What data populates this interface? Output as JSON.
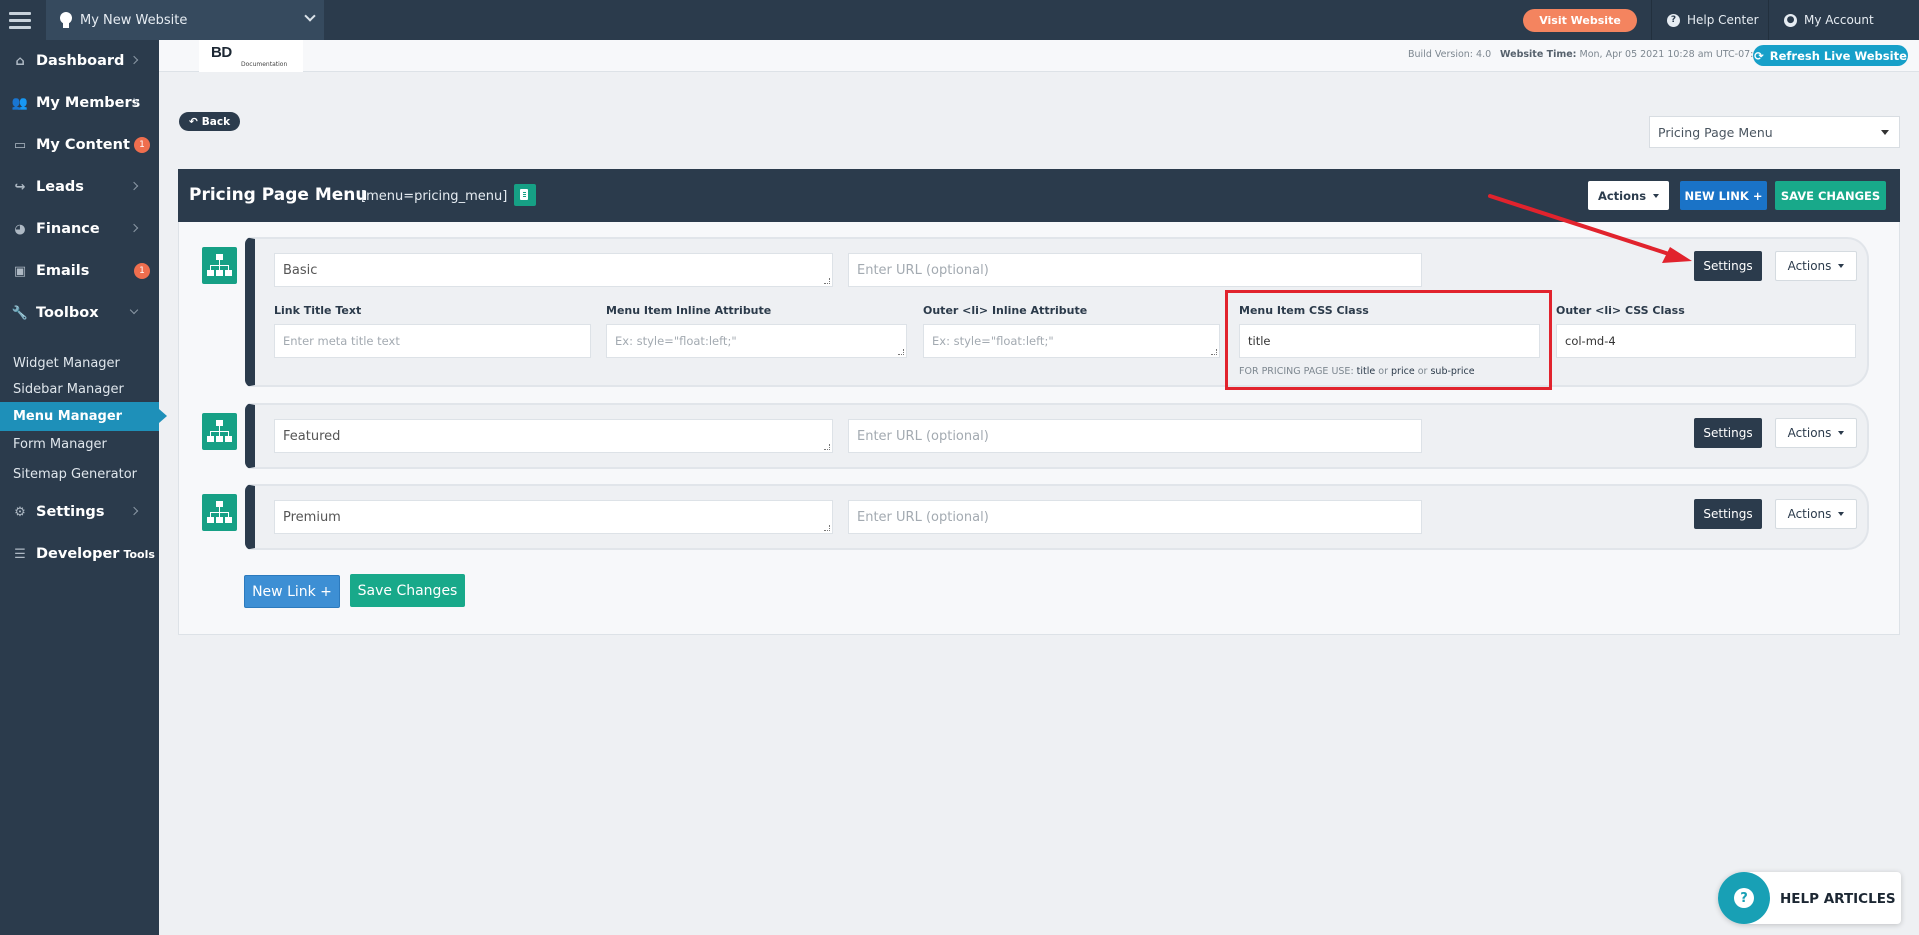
{
  "topbar": {
    "site_name": "My New Website",
    "visit_label": "Visit Website",
    "help_center": "Help Center",
    "my_account": "My Account"
  },
  "sidebar": {
    "items": [
      {
        "label": "Dashboard",
        "icon": "home-icon"
      },
      {
        "label": "My Members",
        "icon": "users-icon"
      },
      {
        "label": "My Content",
        "icon": "folder-icon",
        "badge": "1"
      },
      {
        "label": "Leads",
        "icon": "share-icon"
      },
      {
        "label": "Finance",
        "icon": "pie-chart-icon"
      },
      {
        "label": "Emails",
        "icon": "inbox-icon",
        "badge": "1"
      },
      {
        "label": "Toolbox",
        "icon": "wrench-icon"
      }
    ],
    "toolbox_sub": [
      "Widget Manager",
      "Sidebar Manager",
      "Menu Manager",
      "Form Manager",
      "Sitemap Generator"
    ],
    "settings": "Settings",
    "developer": "Developer",
    "developer_small": "Tools"
  },
  "subheader": {
    "logo_text": "BD",
    "logo_sub": "Documentation",
    "build_label": "Build Version: 4.0",
    "time_label": "Website Time:",
    "time_value": "Mon, Apr 05 2021 10:28 am UTC-07:00",
    "refresh_label": "Refresh Live Website"
  },
  "content": {
    "back_label": "Back",
    "menu_select_value": "Pricing Page Menu",
    "panel_title": "Pricing Page Menu",
    "panel_code": "[menu=pricing_menu]",
    "actions_label": "Actions",
    "new_link_label": "NEW LINK +",
    "save_label": "SAVE CHANGES",
    "rows": [
      {
        "title": "Basic",
        "url_placeholder": "Enter URL (optional)"
      },
      {
        "title": "Featured",
        "url_placeholder": "Enter URL (optional)"
      },
      {
        "title": "Premium",
        "url_placeholder": "Enter URL (optional)"
      }
    ],
    "settings_label": "Settings",
    "row_actions_label": "Actions",
    "expanded": {
      "link_title_label": "Link Title Text",
      "link_title_placeholder": "Enter meta title text",
      "inline_attr_label": "Menu Item Inline Attribute",
      "inline_attr_placeholder": "Ex: style=\"float:left;\"",
      "outer_attr_label": "Outer <li> Inline Attribute",
      "outer_attr_placeholder": "Ex: style=\"float:left;\"",
      "css_class_label": "Menu Item CSS Class",
      "css_class_value": "title",
      "hint_prefix": "FOR PRICING PAGE USE:",
      "hint_title": "title",
      "hint_or1": "or",
      "hint_price": "price",
      "hint_or2": "or",
      "hint_subprice": "sub-price",
      "outer_class_label": "Outer <li> CSS Class",
      "outer_class_value": "col-md-4"
    },
    "bottom_new_link": "New Link +",
    "bottom_save": "Save Changes"
  },
  "help_widget": {
    "label": "HELP ARTICLES"
  },
  "colors": {
    "sidebar": "#2b3b4c",
    "accent_teal": "#16a085",
    "accent_blue": "#1e90b9",
    "highlight_red": "#e1232d"
  }
}
